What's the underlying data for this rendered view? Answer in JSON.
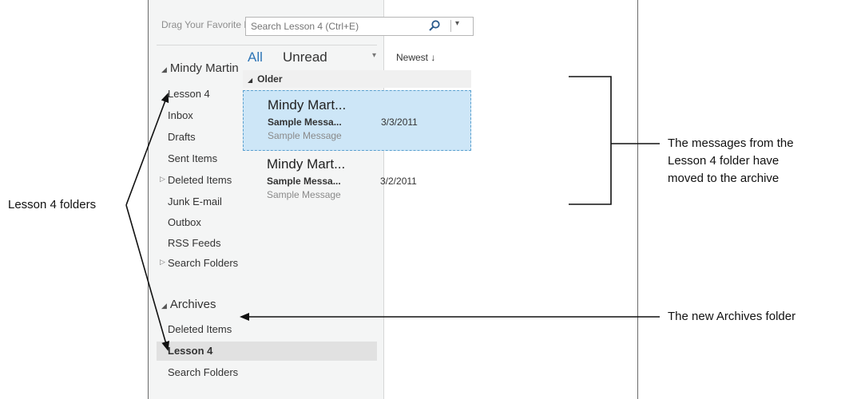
{
  "folder_pane": {
    "favorites_placeholder": "Drag Your Favorite Folders Here",
    "collapse_glyph": "‹",
    "account": {
      "name": "Mindy Martin",
      "folders": [
        "Lesson 4",
        "Inbox",
        "Drafts",
        "Sent Items",
        "Deleted Items",
        "Junk E-mail",
        "Outbox",
        "RSS Feeds",
        "Search Folders"
      ]
    },
    "archives": {
      "name": "Archives",
      "folders": [
        "Deleted Items",
        "Lesson 4",
        "Search Folders"
      ],
      "selected": "Lesson 4"
    }
  },
  "message_pane": {
    "search_placeholder": "Search Lesson 4 (Ctrl+E)",
    "filters": {
      "all": "All",
      "unread": "Unread",
      "sort": "Newest ↓"
    },
    "group_label": "Older",
    "messages": [
      {
        "from": "Mindy Mart...",
        "subject": "Sample Messa...",
        "date": "3/3/2011",
        "preview": "Sample Message",
        "selected": true
      },
      {
        "from": "Mindy Mart...",
        "subject": "Sample Messa...",
        "date": "3/2/2011",
        "preview": "Sample Message",
        "selected": false
      }
    ]
  },
  "callouts": {
    "left": "Lesson 4 folders",
    "right_top_1": "The messages from the",
    "right_top_2": "Lesson 4 folder have",
    "right_top_3": "moved to the archive",
    "right_bottom": "The new Archives folder"
  },
  "colors": {
    "accent": "#2e75b6",
    "selected_message_bg": "#cde6f7",
    "selected_folder_bg": "#e1e1e1",
    "pane_bg": "#f4f5f5"
  }
}
